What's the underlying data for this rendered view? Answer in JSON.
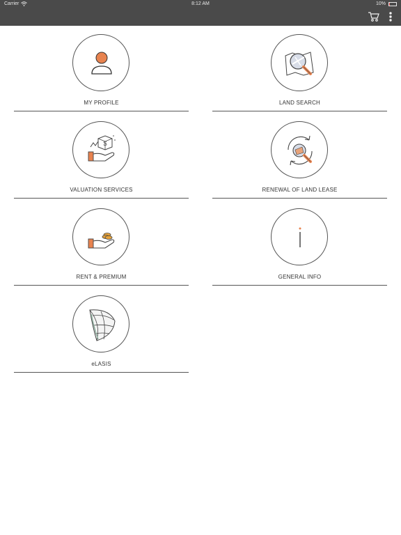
{
  "status_bar": {
    "carrier": "Carrier",
    "time": "8:12 AM",
    "battery": "10%",
    "battery_level": 0.1
  },
  "toolbar": {
    "cart_icon": "cart-icon",
    "menu_icon": "more-vertical-icon"
  },
  "colors": {
    "accent": "#e8834f",
    "bar": "#4a4a4a",
    "line": "#555555"
  },
  "menu": {
    "items": [
      {
        "label": "MY PROFILE",
        "icon": "user-icon"
      },
      {
        "label": "LAND SEARCH",
        "icon": "map-search-icon"
      },
      {
        "label": "VALUATION SERVICES",
        "icon": "valuation-icon"
      },
      {
        "label": "RENEWAL OF LAND LEASE",
        "icon": "renewal-icon"
      },
      {
        "label": "RENT & PREMIUM",
        "icon": "coins-hand-icon"
      },
      {
        "label": "GENERAL INFO",
        "icon": "info-icon"
      },
      {
        "label": "eLASIS",
        "icon": "globe-map-icon"
      }
    ]
  }
}
